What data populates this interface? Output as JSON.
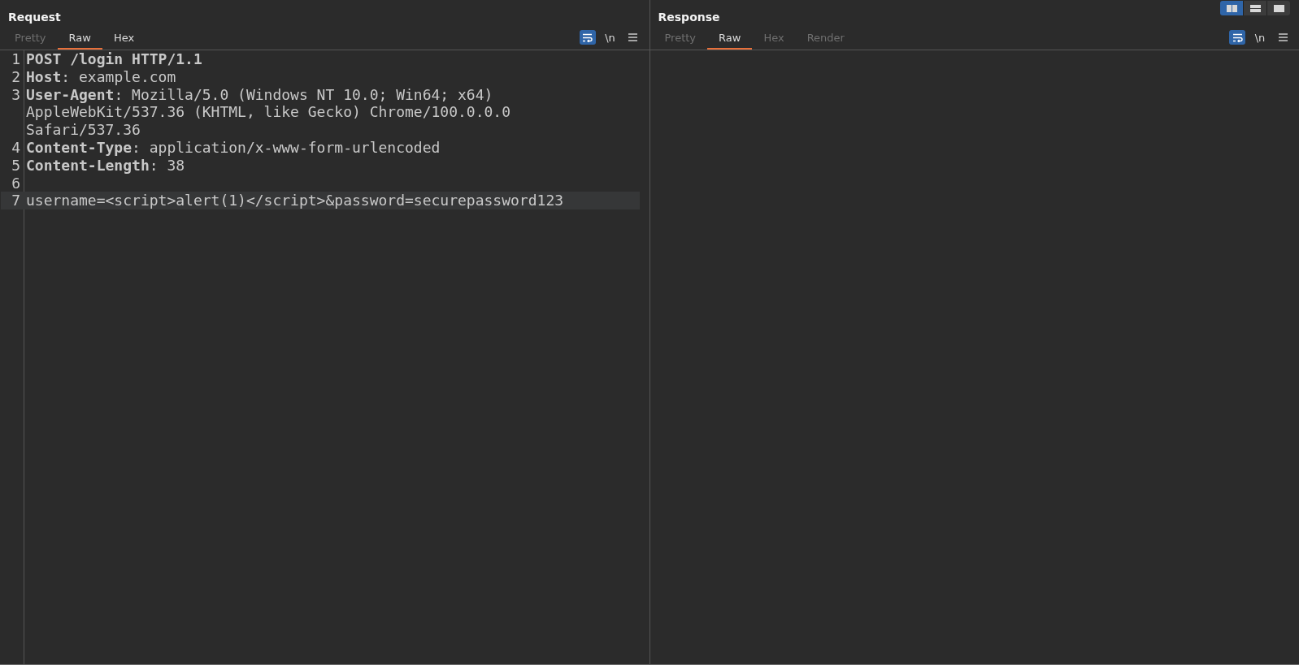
{
  "layout_toggle": [
    {
      "kind": "columns",
      "selected": true
    },
    {
      "kind": "rows",
      "selected": false
    },
    {
      "kind": "single",
      "selected": false
    }
  ],
  "panels": [
    {
      "title": "Request",
      "tabs": [
        {
          "label": "Pretty",
          "selected": false,
          "disabled": true
        },
        {
          "label": "Raw",
          "selected": true,
          "disabled": false
        },
        {
          "label": "Hex",
          "selected": false,
          "disabled": false
        }
      ],
      "tools": {
        "wrap_on": true,
        "newline_label": "\\n"
      },
      "lines": [
        {
          "number": "1",
          "text": "**POST /login HTTP/1.1**",
          "current": false
        },
        {
          "number": "2",
          "text": "**Host**: example.com",
          "current": false
        },
        {
          "number": "3",
          "text": "**User-Agent**: Mozilla/5.0 (Windows NT 10.0; Win64; x64) AppleWebKit/537.36 (KHTML, like Gecko) Chrome/100.0.0.0 Safari/537.36",
          "current": false
        },
        {
          "number": "4",
          "text": "**Content-Type**: application/x-www-form-urlencoded",
          "current": false
        },
        {
          "number": "5",
          "text": "**Content-Length**: 38",
          "current": false
        },
        {
          "number": "6",
          "current": false
        },
        {
          "number": "7",
          "text": "username=<script>alert(1)</script>&password=securepassword123",
          "current": true
        }
      ]
    },
    {
      "title": "Response",
      "tabs": [
        {
          "label": "Pretty",
          "selected": false,
          "disabled": true
        },
        {
          "label": "Raw",
          "selected": true,
          "disabled": false
        },
        {
          "label": "Hex",
          "selected": false,
          "disabled": true
        },
        {
          "label": "Render",
          "selected": false,
          "disabled": true
        }
      ],
      "tools": {
        "wrap_on": true,
        "newline_label": "\\n"
      }
    }
  ]
}
